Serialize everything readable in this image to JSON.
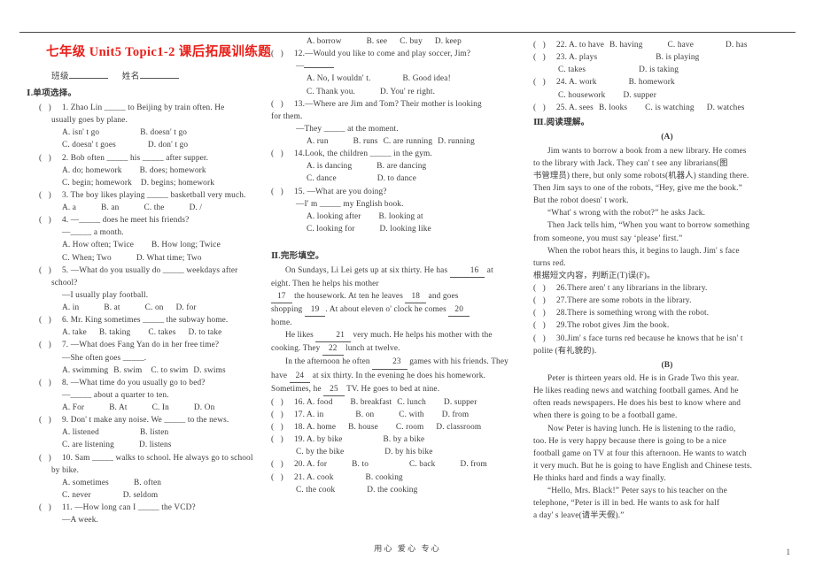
{
  "document": {
    "title": "七年级 Unit5 Topic1-2 课后拓展训练题",
    "class_label": "班级",
    "name_label": "姓名",
    "footer": "用心 爱心 专心",
    "page_number": "1"
  },
  "sections": {
    "s1_head": "Ⅰ.单项选择。",
    "s2_head": "Ⅱ.完形填空。",
    "s3_head": "Ⅲ.阅读理解。"
  },
  "multiple_choice": [
    {
      "num": "1.",
      "stem": "Zhao Lin _____ to Beijing by train often. He",
      "stem2": "usually goes by plane.",
      "a": "A. isn' t go",
      "b": "B. doesn' t go",
      "c": "C. doesn' t goes",
      "d": "D. don' t go"
    },
    {
      "num": "2.",
      "stem": "Bob often _____ his _____ after supper.",
      "a": "A. do; homework",
      "b": "B. does; homework",
      "c": "C. begin; homework",
      "d": "D. begins; homework"
    },
    {
      "num": "3.",
      "stem": "The boy likes playing _____ basketball very much.",
      "a": "A. a",
      "b": "B. an",
      "c": "C. the",
      "d": "D. /"
    },
    {
      "num": "4.",
      "stem": "—_____ does he meet his friends?",
      "stem2": "—_____ a month.",
      "a": "A. How often; Twice",
      "b": "B. How long; Twice",
      "c": "C. When; Two",
      "d": "D. What time; Two"
    },
    {
      "num": "5.",
      "stem": "—What do you usually do _____ weekdays after",
      "stem2": "school?",
      "stem3": "—I usually play football.",
      "a": "A. in",
      "b": "B. at",
      "c": "C. on",
      "d": "D. for"
    },
    {
      "num": "6.",
      "stem": "Mr. King sometimes _____ the subway home.",
      "a": "A. take",
      "b": "B. taking",
      "c": "C. takes",
      "d": "D. to take"
    },
    {
      "num": "7.",
      "stem": "—What does Fang Yan do in her free time?",
      "stem2": "—She often goes _____.",
      "a": "A. swimming",
      "b": "B. swim",
      "c": "C. to swim",
      "d": "D. swims"
    },
    {
      "num": "8.",
      "stem": "—What time do you usually go to bed?",
      "stem2": "—_____ about a quarter to ten.",
      "a": "A. For",
      "b": "B. At",
      "c": "C. In",
      "d": "D. On"
    },
    {
      "num": "9.",
      "stem": "Don' t make any noise. We _____ to the news.",
      "a": "A. listened",
      "b": "B. listen",
      "c": "C. are listening",
      "d": "D. listens"
    },
    {
      "num": "10.",
      "stem": "Sam _____ walks to school. He always go to school",
      "stem2": "by bike.",
      "a": "A. sometimes",
      "b": "B. often",
      "c": "C. never",
      "d": "D. seldom"
    },
    {
      "num": "11.",
      "stem": "—How long can I _____ the VCD?",
      "stem2": "—A week.",
      "a": "A. borrow",
      "b": "B. see",
      "c": "C. buy",
      "d": "D. keep"
    },
    {
      "num": "12.",
      "stem": "—Would you like to come and play soccer, Jim?",
      "stem2": "—_____",
      "a": "A. No, I wouldn' t.",
      "b": "B. Good idea!",
      "c": "C. Thank you.",
      "d": "D. You' re right."
    },
    {
      "num": "13.",
      "stem": "—Where are Jim and Tom? Their mother is looking",
      "stem2": "for them.",
      "stem3": "—They _____ at the moment.",
      "a": "A. run",
      "b": "B. runs",
      "c": "C. are running",
      "d": "D. running"
    },
    {
      "num": "14.",
      "stem": "Look, the children _____ in the gym.",
      "a": "A. is dancing",
      "b": "B. are dancing",
      "c": "C. dance",
      "d": "D. to dance"
    },
    {
      "num": "15.",
      "stem": "—What are you doing?",
      "stem2": "—I' m _____ my English book.",
      "a": "A. looking after",
      "b": "B. looking at",
      "c": "C. looking for",
      "d": "D. looking like"
    }
  ],
  "cloze": {
    "para1_a": "On Sundays, Li Lei gets up at six thirty. He has ",
    "n16": "16",
    "para1_b": " at",
    "para1_c": "eight. Then he helps his mother",
    "para2_a": "",
    "n17": "17",
    "para2_b": " the housework. At ten he leaves ",
    "n18": "18",
    "para2_c": " and goes",
    "para2_d": "shopping ",
    "n19": "19",
    "para2_e": ". At about eleven o' clock he comes ",
    "n20": "20",
    "para2_f": "home.",
    "para3_a": "He likes ",
    "n21": "21",
    "para3_b": " very much. He helps his mother with the",
    "para3_c": "cooking. They ",
    "n22": "22",
    "para3_d": " lunch at twelve.",
    "para4_a": "In the afternoon he often ",
    "n23": "23",
    "para4_b": " games with his friends. They",
    "para4_c": "have ",
    "n24": "24",
    "para4_d": " at six thirty. In the evening he does his homework.",
    "para4_e": "Sometimes, he ",
    "n25": "25",
    "para4_f": " TV. He goes to bed at nine.",
    "options": [
      {
        "num": "16.",
        "a": "A. food",
        "b": "B. breakfast",
        "c": "C. lunch",
        "d": "D. supper"
      },
      {
        "num": "17.",
        "a": "A. in",
        "b": "B. on",
        "c": "C. with",
        "d": "D. from"
      },
      {
        "num": "18.",
        "a": "A. home",
        "b": "B. house",
        "c": "C. room",
        "d": "D. classroom"
      },
      {
        "num": "19.",
        "a": "A. by bike",
        "b": "B. by a bike",
        "c": "C. by the bike",
        "d": "D. by his bike"
      },
      {
        "num": "20.",
        "a": "A. for",
        "b": "B. to",
        "c": "C. back",
        "d": "D. from"
      },
      {
        "num": "21.",
        "a": "A. cook",
        "b": "B. cooking",
        "c": "C. the cook",
        "d": "D. the cooking"
      },
      {
        "num": "22.",
        "a": "A. to have",
        "b": "B. having",
        "c": "C. have",
        "d": "D. has"
      },
      {
        "num": "23.",
        "a": "A. plays",
        "b": "B. is playing",
        "c": "C. takes",
        "d": "D. is taking"
      },
      {
        "num": "24.",
        "a": "A. work",
        "b": "B. homework",
        "c": "C. housework",
        "d": "D. supper"
      },
      {
        "num": "25.",
        "a": "A. sees",
        "b": "B. looks",
        "c": "C. is watching",
        "d": "D. watches"
      }
    ]
  },
  "reading": {
    "passage_a": {
      "label": "(A)",
      "p1_l1": "Jim wants to borrow a book from a new library. He comes",
      "p1_l2": "to the library with Jack. They can' t see any librarians(图",
      "p1_l3": "书管理员) there, but only some robots(机器人) standing there.",
      "p1_l4": "Then Jim says to one of the robots, “Hey, give me the book.”",
      "p1_l5": "But the robot doesn' t work.",
      "p2_l1": "“What' s wrong with the robot?” he asks Jack.",
      "p3_l1": "Then Jack tells him, “When you want to borrow something",
      "p3_l2": "from someone, you must say  ‘please’  first.”",
      "p4_l1": "When the robot hears this, it begins to laugh. Jim' s face",
      "p4_l2": "turns red.",
      "instruction": "根据短文内容，判断正(T)误(F)。",
      "questions": [
        {
          "num": "26.",
          "text": "There aren' t any librarians in the library."
        },
        {
          "num": "27.",
          "text": "There are some robots in the library."
        },
        {
          "num": "28.",
          "text": "There is something wrong with the robot."
        },
        {
          "num": "29.",
          "text": "The robot gives Jim the book."
        },
        {
          "num": "30.",
          "text": "Jim' s face turns red because he knows that he isn' t"
        }
      ],
      "q30_cont": "polite (有礼貌的)."
    },
    "passage_b": {
      "label": "(B)",
      "p1_l1": "Peter is thirteen years old. He is in Grade Two this year.",
      "p1_l2": "He likes reading news and watching football games. And he",
      "p1_l3": "often reads newspapers. He does his best to know where and",
      "p1_l4": "when there is going to be a football game.",
      "p2_l1": "Now Peter is having lunch. He is listening to the radio,",
      "p2_l2": "too. He is very happy because there is going to be a nice",
      "p2_l3": "football game on TV at four this afternoon. He wants to watch",
      "p2_l4": "it very much. But he is going to have English and Chinese tests.",
      "p2_l5": "He thinks hard and finds a way finally.",
      "p3_l1": "“Hello, Mrs. Black!” Peter says to his teacher on the",
      "p3_l2": "telephone, “Peter is ill in bed. He wants to ask for half",
      "p3_l3": "a day' s leave(请半天假).”"
    }
  }
}
